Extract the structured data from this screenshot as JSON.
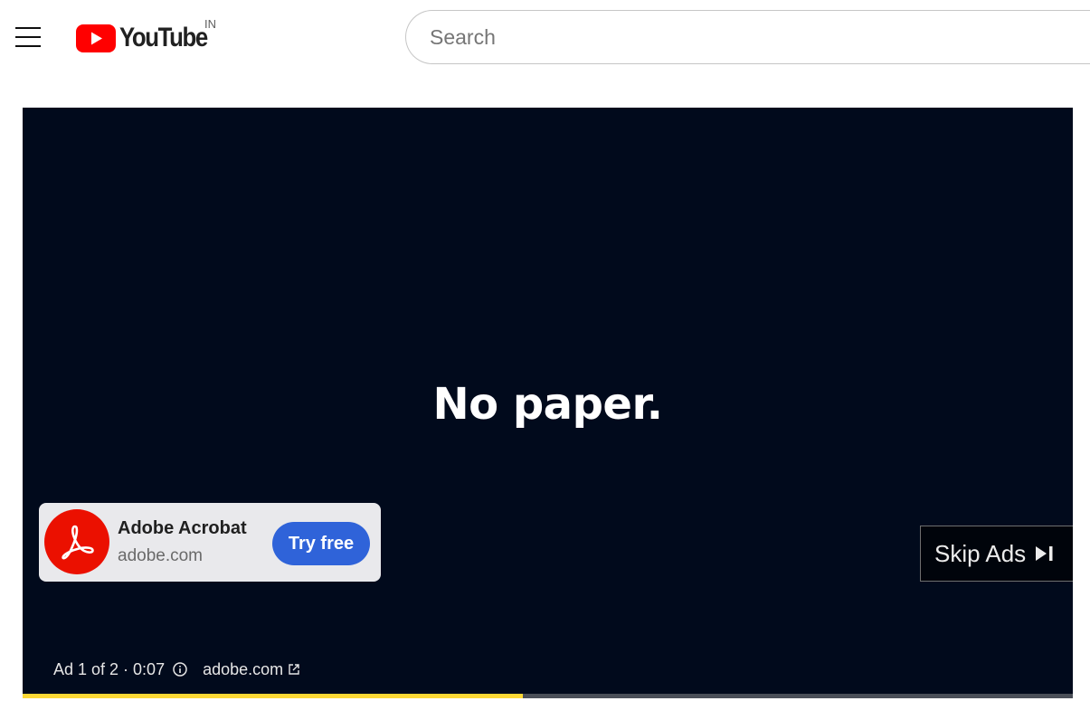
{
  "header": {
    "logo_text": "YouTube",
    "country_code": "IN",
    "search_placeholder": "Search"
  },
  "player": {
    "headline": "No paper.",
    "ad_card": {
      "advertiser": "Adobe Acrobat",
      "domain": "adobe.com",
      "cta_label": "Try free"
    },
    "skip_label": "Skip Ads",
    "ad_info": {
      "status": "Ad 1 of 2 · 0:07",
      "link_text": "adobe.com"
    },
    "progress_fraction": 0.476
  },
  "colors": {
    "youtube_red": "#ff0000",
    "player_bg": "#010a1c",
    "cta_blue": "#2f63d9",
    "ad_progress_yellow": "#fdd835",
    "adobe_red": "#eb1000"
  },
  "icons": {
    "menu": "hamburger-icon",
    "logo": "youtube-play-icon",
    "ad_logo": "adobe-acrobat-icon",
    "skip": "skip-next-icon",
    "info": "info-icon",
    "external": "external-link-icon"
  }
}
